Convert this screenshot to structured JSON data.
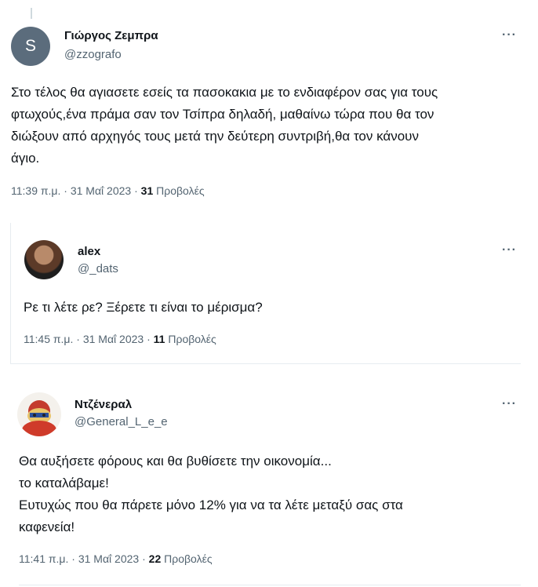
{
  "tweets": [
    {
      "name": "Γιώργος Ζεμπρα",
      "handle": "@zzografo",
      "avatar_letter": "S",
      "text": "Στο τέλος θα αγιασετε εσείς τα πασοκακια με το ενδιαφέρον σας για τους\nφτωχούς,ένα πράμα σαν τον Τσίπρα δηλαδή, μαθαίνω τώρα που θα τον\nδιώξουν από αρχηγός τους μετά την δεύτερη συντριβή,θα τον κάνουν\nάγιο.",
      "time": "11:39 π.μ.",
      "date": "31 Μαΐ 2023",
      "views_count": "31",
      "views_label": "Προβολές"
    },
    {
      "name": "alex",
      "handle": "@_dats",
      "text": "Ρε τι λέτε ρε? Ξέρετε τι είναι το μέρισμα?",
      "time": "11:45 π.μ.",
      "date": "31 Μαΐ 2023",
      "views_count": "11",
      "views_label": "Προβολές"
    },
    {
      "name": "Ντζένεραλ",
      "handle": "@General_L_e_e",
      "text": "Θα αυξήσετε φόρους και θα βυθίσετε την οικονομία...\nτο καταλάβαμε!\nΕυτυχώς που θα πάρετε μόνο 12% για να τα λέτε μεταξύ σας στα\nκαφενεία!",
      "time": "11:41 π.μ.",
      "date": "31 Μαΐ 2023",
      "views_count": "22",
      "views_label": "Προβολές"
    }
  ],
  "more_label": "···",
  "separator": "·",
  "icons": {
    "more": "more-options-icon"
  }
}
